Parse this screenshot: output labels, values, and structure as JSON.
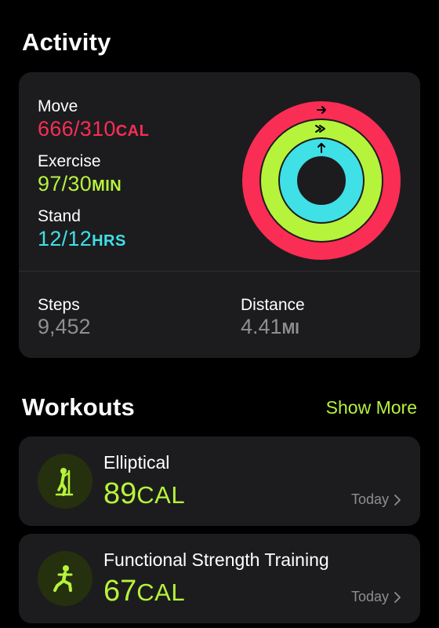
{
  "activity": {
    "title": "Activity",
    "move": {
      "label": "Move",
      "value": "666/310",
      "unit": "CAL",
      "progress": 2.148
    },
    "exercise": {
      "label": "Exercise",
      "value": "97/30",
      "unit": "MIN",
      "progress": 3.233
    },
    "stand": {
      "label": "Stand",
      "value": "12/12",
      "unit": "HRS",
      "progress": 1.0
    },
    "steps": {
      "label": "Steps",
      "value": "9,452"
    },
    "distance": {
      "label": "Distance",
      "value": "4.41",
      "unit": "MI"
    }
  },
  "workouts": {
    "title": "Workouts",
    "show_more": "Show More",
    "items": [
      {
        "name": "Elliptical",
        "value": "89",
        "unit": "CAL",
        "date": "Today",
        "icon": "elliptical-icon"
      },
      {
        "name": "Functional Strength Training",
        "value": "67",
        "unit": "CAL",
        "date": "Today",
        "icon": "strength-training-icon"
      }
    ]
  },
  "colors": {
    "move": "#fa2d55",
    "exercise": "#b6f33b",
    "stand": "#3fe0e6",
    "card": "#1c1c1e",
    "secondary_text": "#8e8e93"
  }
}
